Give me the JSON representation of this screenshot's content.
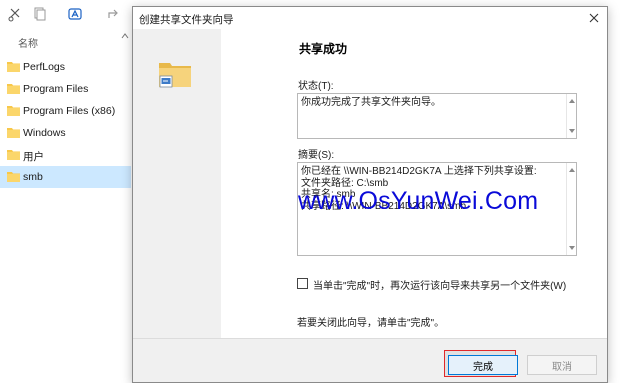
{
  "explorer": {
    "column_header": "名称",
    "items": [
      {
        "label": "PerfLogs"
      },
      {
        "label": "Program Files"
      },
      {
        "label": "Program Files (x86)"
      },
      {
        "label": "Windows"
      },
      {
        "label": "用户"
      },
      {
        "label": "smb",
        "selected": true
      }
    ]
  },
  "dialog": {
    "title": "创建共享文件夹向导",
    "heading": "共享成功",
    "status_label": "状态(T):",
    "status_text": "你成功完成了共享文件夹向导。",
    "summary_label": "摘要(S):",
    "summary_text": "你已经在 \\\\WIN-BB214D2GK7A 上选择下列共享设置:\n文件夹路径: C:\\smb\n共享名: smb\n共享路径: \\\\WIN-BB214D2GK7A\\smb",
    "checkbox_label": "当单击\"完成\"时，再次运行该向导来共享另一个文件夹(W)",
    "checkbox_checked": false,
    "close_note": "若要关闭此向导，请单击\"完成\"。",
    "finish_button": "完成",
    "cancel_button": "取消"
  },
  "watermark": "www.OsYunWei.Com",
  "colors": {
    "selection": "#cce8ff",
    "dialog_side": "#f0f0f0",
    "highlight": "#e0282a",
    "watermark": "#0a0ad8"
  }
}
